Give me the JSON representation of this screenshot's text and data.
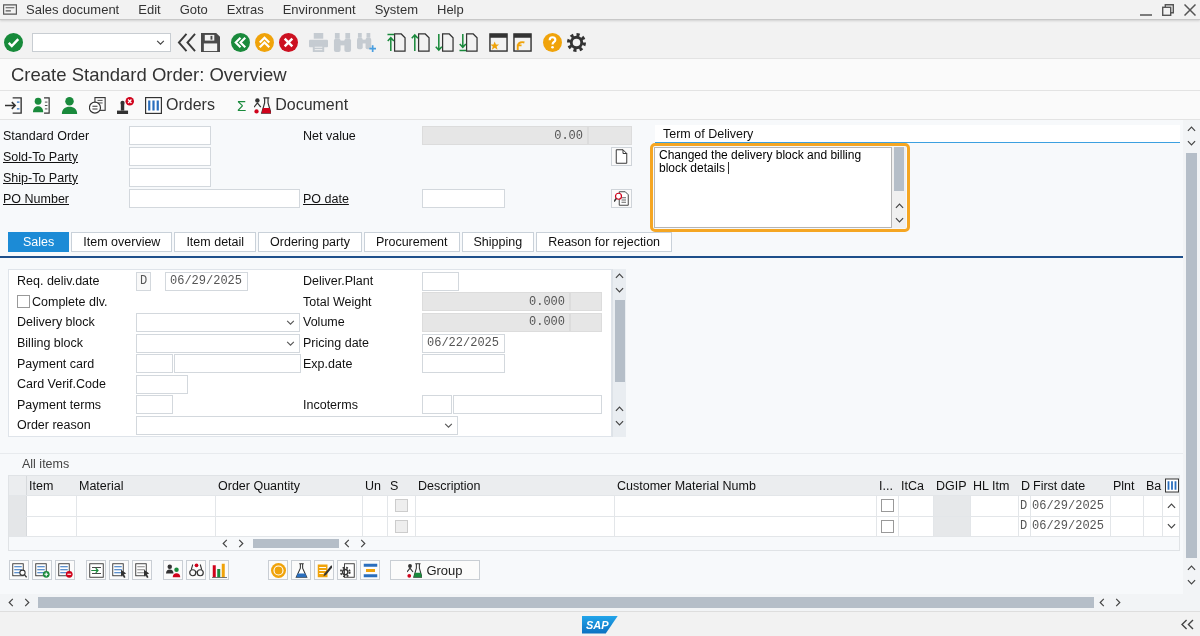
{
  "menu_bar": {
    "items": [
      "Sales document",
      "Edit",
      "Goto",
      "Extras",
      "Environment",
      "System",
      "Help"
    ]
  },
  "screen_title": "Create Standard Order: Overview",
  "app_toolbar": {
    "orders_button": "Orders",
    "sum_button": "Σ",
    "document_button": "Document"
  },
  "header": {
    "standard_order": {
      "label": "Standard Order",
      "linked": false
    },
    "sold_to_party": {
      "label": "Sold-To Party",
      "linked": true
    },
    "ship_to_party": {
      "label": "Ship-To Party",
      "linked": true
    },
    "po_number": {
      "label": "PO Number",
      "linked": true
    },
    "net_value": {
      "label": "Net value",
      "linked": false,
      "value": "0.00",
      "read_only": true
    },
    "po_date": {
      "label": "PO date",
      "linked": true
    }
  },
  "term_of_delivery": {
    "label": "Term of Delivery",
    "text": "Changed the delivery block and billing block details",
    "highlighted": true
  },
  "tabs": [
    {
      "label": "Sales",
      "selected": true
    },
    {
      "label": "Item overview",
      "selected": false
    },
    {
      "label": "Item detail",
      "selected": false
    },
    {
      "label": "Ordering party",
      "selected": false
    },
    {
      "label": "Procurement",
      "selected": false
    },
    {
      "label": "Shipping",
      "selected": false
    },
    {
      "label": "Reason for rejection",
      "selected": false
    }
  ],
  "sales": {
    "req_deliv_date": {
      "label": "Req. deliv.date",
      "format": "D",
      "value": "06/29/2025",
      "read_only": false
    },
    "deliver_plant": {
      "label": "Deliver.Plant"
    },
    "complete_dlv": {
      "label": "Complete dlv.",
      "checked": false
    },
    "total_weight": {
      "label": "Total Weight",
      "value": "0.000",
      "read_only": true
    },
    "delivery_block": {
      "label": "Delivery block"
    },
    "volume": {
      "label": "Volume",
      "value": "0.000",
      "read_only": true
    },
    "billing_block": {
      "label": "Billing block"
    },
    "pricing_date": {
      "label": "Pricing date",
      "value": "06/22/2025",
      "read_only": false
    },
    "payment_card": {
      "label": "Payment card"
    },
    "exp_date": {
      "label": "Exp.date"
    },
    "card_verif_code": {
      "label": "Card Verif.Code"
    },
    "payment_terms": {
      "label": "Payment terms"
    },
    "incoterms": {
      "label": "Incoterms"
    },
    "order_reason": {
      "label": "Order reason"
    }
  },
  "items": {
    "title": "All items",
    "columns": [
      "Item",
      "Material",
      "Order Quantity",
      "Un",
      "S",
      "Description",
      "Customer Material Numb",
      "I...",
      "ItCa",
      "DGIP",
      "HL Itm",
      "D",
      "First date",
      "Plnt",
      "Ba"
    ],
    "rows": [
      {
        "cells": [
          {
            "kind": "blank"
          },
          {
            "kind": "blank"
          },
          {
            "kind": "blank"
          },
          {
            "kind": "blank"
          },
          {
            "kind": "checkbox",
            "checked": false,
            "disabled": true
          },
          {
            "kind": "blank"
          },
          {
            "kind": "blank"
          },
          {
            "kind": "checkbox",
            "checked": false,
            "disabled": false
          },
          {
            "kind": "blank"
          },
          {
            "kind": "readonly"
          },
          {
            "kind": "blank"
          },
          {
            "kind": "text",
            "text": "D"
          },
          {
            "kind": "text",
            "text": "06/29/2025"
          },
          {
            "kind": "blank"
          },
          {
            "kind": "blank"
          }
        ]
      },
      {
        "cells": [
          {
            "kind": "blank"
          },
          {
            "kind": "blank"
          },
          {
            "kind": "blank"
          },
          {
            "kind": "blank"
          },
          {
            "kind": "checkbox",
            "checked": false,
            "disabled": true
          },
          {
            "kind": "blank"
          },
          {
            "kind": "blank"
          },
          {
            "kind": "checkbox",
            "checked": false,
            "disabled": false
          },
          {
            "kind": "blank"
          },
          {
            "kind": "readonly"
          },
          {
            "kind": "blank"
          },
          {
            "kind": "text",
            "text": "D"
          },
          {
            "kind": "text",
            "text": "06/29/2025"
          },
          {
            "kind": "blank"
          },
          {
            "kind": "blank"
          }
        ]
      }
    ]
  },
  "table_toolbar": {
    "group_button": "Group"
  },
  "status_bar": {
    "logo": "SAP"
  }
}
